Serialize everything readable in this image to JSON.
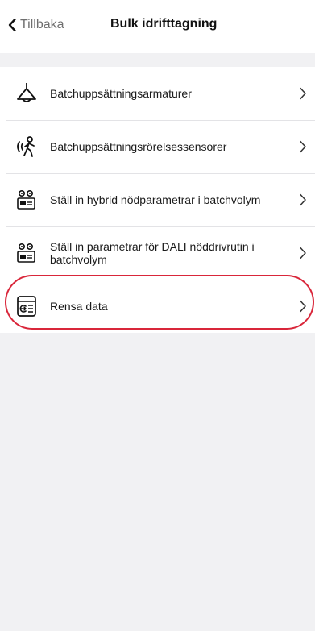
{
  "header": {
    "back_label": "Tillbaka",
    "title": "Bulk idrifttagning"
  },
  "menu": {
    "items": [
      {
        "label": "Batchuppsättningsarmaturer",
        "icon": "ceiling-lamp-icon"
      },
      {
        "label": "Batchuppsättningsrörelsessensorer",
        "icon": "motion-sensor-icon"
      },
      {
        "label": "Ställ in hybrid nödparametrar i batchvolym",
        "icon": "emergency-device-icon"
      },
      {
        "label": "Ställ in parametrar för DALI nöddrivrutin i batchvolym",
        "icon": "dali-emergency-driver-icon"
      },
      {
        "label": "Rensa data",
        "icon": "clear-data-icon"
      }
    ]
  },
  "colors": {
    "highlight": "#d9263a",
    "background": "#f1f1f3"
  }
}
